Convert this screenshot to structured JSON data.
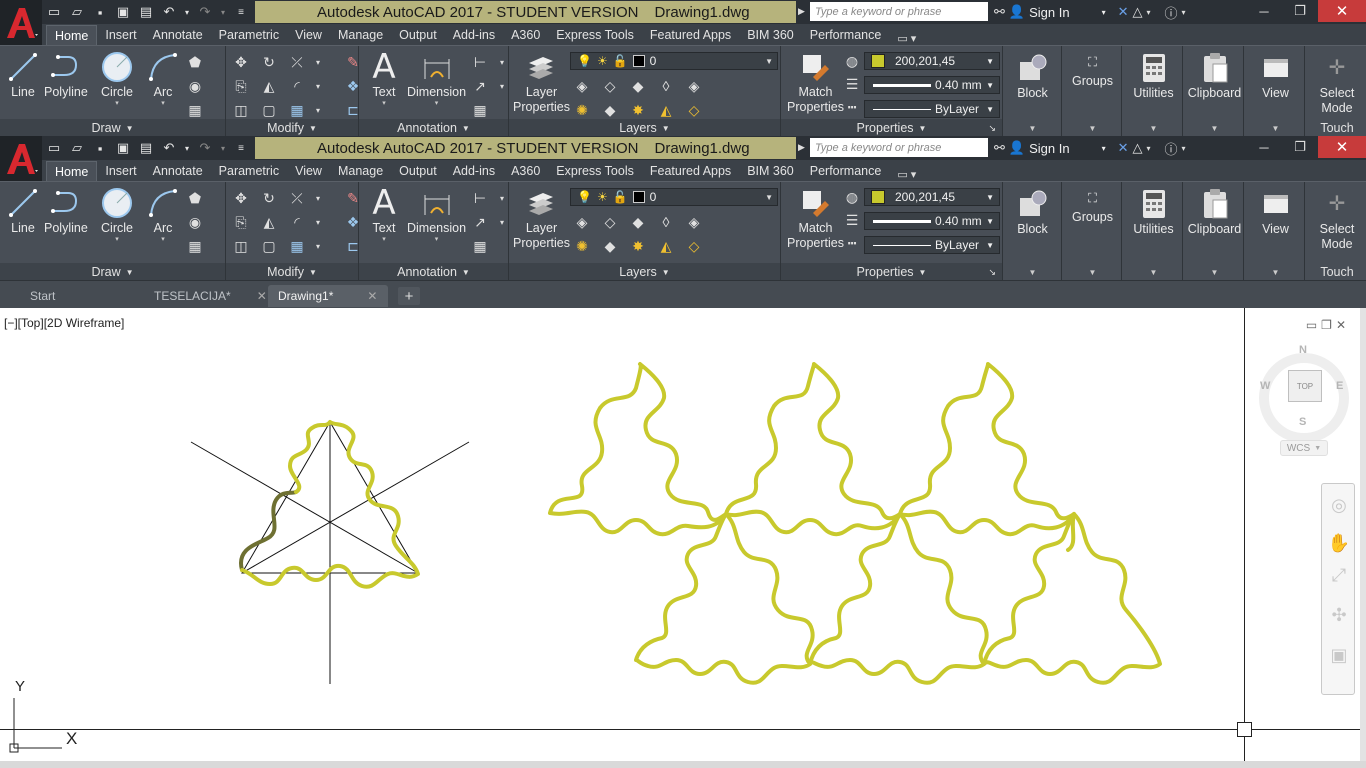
{
  "window": {
    "title": "Autodesk AutoCAD 2017 - STUDENT VERSION",
    "document": "Drawing1.dwg",
    "search_placeholder": "Type a keyword or phrase",
    "sign_in": "Sign In"
  },
  "ribbon_tabs": [
    {
      "label": "Home",
      "active": true
    },
    {
      "label": "Insert"
    },
    {
      "label": "Annotate"
    },
    {
      "label": "Parametric"
    },
    {
      "label": "View"
    },
    {
      "label": "Manage"
    },
    {
      "label": "Output"
    },
    {
      "label": "Add-ins"
    },
    {
      "label": "A360"
    },
    {
      "label": "Express Tools"
    },
    {
      "label": "Featured Apps"
    },
    {
      "label": "BIM 360"
    },
    {
      "label": "Performance"
    }
  ],
  "draw": {
    "title": "Draw",
    "line": "Line",
    "polyline": "Polyline",
    "circle": "Circle",
    "arc": "Arc"
  },
  "modify": {
    "title": "Modify"
  },
  "annotation": {
    "title": "Annotation",
    "text": "Text",
    "dimension": "Dimension"
  },
  "layers": {
    "title": "Layers",
    "layer_properties_1": "Layer",
    "layer_properties_2": "Properties",
    "current_layer": "0"
  },
  "properties": {
    "title": "Properties",
    "match_1": "Match",
    "match_2": "Properties",
    "color": "200,201,45",
    "color_hex": "#c8c92d",
    "lineweight": "0.40 mm",
    "linetype": "ByLayer"
  },
  "side_tools": {
    "block": "Block",
    "groups": "Groups",
    "utilities": "Utilities",
    "clipboard": "Clipboard",
    "view": "View",
    "select_1": "Select",
    "select_2": "Mode",
    "touch": "Touch"
  },
  "file_tabs": [
    {
      "label": "Start"
    },
    {
      "label": "TESELACIJA*"
    },
    {
      "label": "Drawing1*",
      "active": true
    }
  ],
  "viewport": {
    "label": "[−][Top][2D Wireframe]",
    "compass_n": "N",
    "compass_s": "S",
    "compass_e": "E",
    "compass_w": "W",
    "cube_face": "TOP",
    "wcs": "WCS",
    "ucs_x": "X",
    "ucs_y": "Y"
  },
  "colors": {
    "curve": "#c8c92d",
    "curve_dark": "#6e7032",
    "accent_red": "#c73b3b"
  }
}
